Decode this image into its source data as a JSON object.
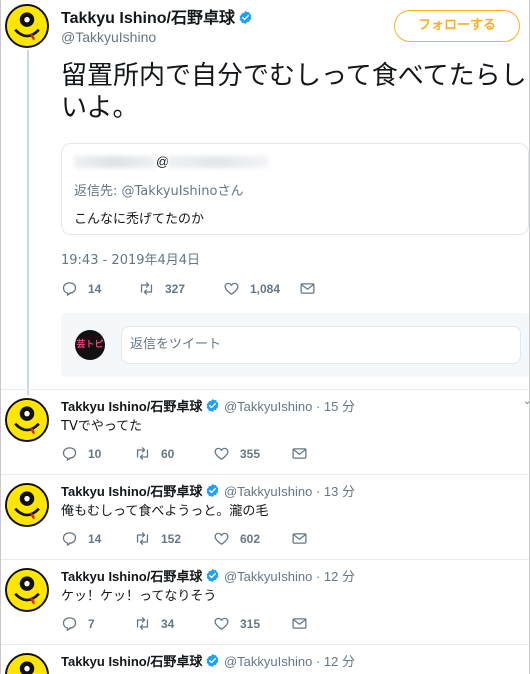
{
  "main_tweet": {
    "display_name": "Takkyu Ishino/石野卓球",
    "handle": "@TakkyuIshino",
    "follow_label": "フォローする",
    "text": "留置所内で自分でむしって食べてたらしいよ。",
    "quoted": {
      "at_symbol": "@",
      "reply_to": "返信先: @TakkyuIshinoさん",
      "text": "こんなに禿げてたのか"
    },
    "timestamp": "19:43 - 2019年4月4日",
    "stats": {
      "replies": "14",
      "retweets": "327",
      "likes": "1,084"
    }
  },
  "reply_composer": {
    "logo_text": "芸トピ",
    "placeholder": "返信をツイート"
  },
  "replies": [
    {
      "name": "Takkyu Ishino/石野卓球",
      "handle": "@TakkyuIshino",
      "time": "· 15 分",
      "text": "TVでやってた",
      "replies": "10",
      "retweets": "60",
      "likes": "355"
    },
    {
      "name": "Takkyu Ishino/石野卓球",
      "handle": "@TakkyuIshino",
      "time": "· 13 分",
      "text": "俺もむしって食べようっと。瀧の毛",
      "replies": "14",
      "retweets": "152",
      "likes": "602"
    },
    {
      "name": "Takkyu Ishino/石野卓球",
      "handle": "@TakkyuIshino",
      "time": "· 12 分",
      "text": "ケッ！ケッ！ってなりそう",
      "replies": "7",
      "retweets": "34",
      "likes": "315"
    },
    {
      "name": "Takkyu Ishino/石野卓球",
      "handle": "@TakkyuIshino",
      "time": "· 12 分",
      "text": "",
      "replies": "",
      "retweets": "",
      "likes": ""
    }
  ],
  "colors": {
    "accent_follow": "#ffad1f",
    "verified": "#1da1f2",
    "secondary_text": "#657786",
    "avatar_yellow": "#ffe600"
  },
  "icons": [
    "verified-badge-icon",
    "reply-icon",
    "retweet-icon",
    "like-icon",
    "share-mail-icon",
    "chevron-down-icon"
  ]
}
